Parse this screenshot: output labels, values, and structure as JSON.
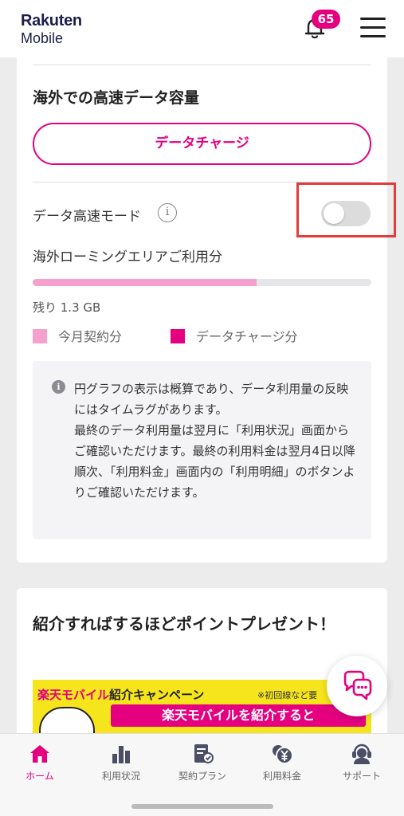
{
  "header": {
    "logo_line1": "Rakuten",
    "logo_line2": "Mobile",
    "notification_count": "65"
  },
  "overseas": {
    "title": "海外での高速データ容量",
    "charge_button": "データチャージ",
    "high_speed_mode_label": "データ高速モード",
    "high_speed_mode_on": false,
    "info_icon": "i",
    "roaming_label": "海外ローミングエリアご利用分",
    "usage_fraction": 0.66,
    "remaining": "残り 1.3 GB",
    "legend": [
      {
        "label": "今月契約分",
        "color": "#f5a0cd"
      },
      {
        "label": "データチャージ分",
        "color": "#e4007f"
      }
    ],
    "note_icon": "i",
    "note": "円グラフの表示は概算であり、データ利用量の反映にはタイムラグがあります。\n最終のデータ利用量は翌月に「利用状況」画面からご確認いただけます。最終の利用料金は翌月4日以降順次、「利用料金」画面内の「利用明細」のボタンよりご確認いただけます。"
  },
  "referral": {
    "title": "紹介すればするほどポイントプレゼント！",
    "banner_brand": "楽天モバイル",
    "banner_campaign": "紹介キャンペーン",
    "banner_note": "※初回線など要",
    "banner_line2": "楽天モバイルを紹介すると"
  },
  "tabs": [
    {
      "label": "ホーム",
      "icon": "home-icon",
      "active": true
    },
    {
      "label": "利用状況",
      "icon": "bar-chart-icon",
      "active": false
    },
    {
      "label": "契約プラン",
      "icon": "contract-icon",
      "active": false
    },
    {
      "label": "利用料金",
      "icon": "yen-coin-icon",
      "active": false
    },
    {
      "label": "サポート",
      "icon": "support-icon",
      "active": false
    }
  ],
  "colors": {
    "accent": "#e4007f",
    "light_pink": "#f5a0cd",
    "highlight_box": "#e53b3b",
    "banner_yellow": "#f6e51d"
  }
}
